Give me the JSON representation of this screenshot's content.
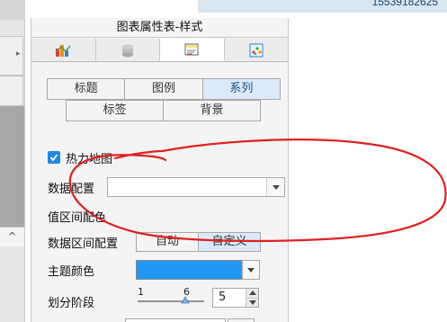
{
  "phone_number": "15539182625",
  "panel": {
    "title": "图表属性表-样式",
    "icon_tabs": [
      {
        "icon": "chart-type-icon"
      },
      {
        "icon": "database-icon"
      },
      {
        "icon": "style-icon"
      },
      {
        "icon": "effects-icon"
      }
    ],
    "tabs_row1": [
      "标题",
      "图例",
      "系列"
    ],
    "tabs_row2": [
      "标签",
      "背景"
    ],
    "active_tab": "系列"
  },
  "form": {
    "heatmap_label": "热力地图",
    "heatmap_checked": true,
    "data_config_label": "数据配置",
    "data_config_value": "",
    "value_range_color_label": "值区间配色",
    "data_range_label": "数据区间配置",
    "range_options": [
      "自动",
      "自定义"
    ],
    "range_selected": "自定义",
    "theme_color_label": "主题颜色",
    "theme_color": "#2196f3",
    "divide_stage_label": "划分阶段",
    "slider_min": "1",
    "slider_value": "6",
    "spin_value": "5"
  },
  "left_strip": {
    "arrow_right": "▸",
    "arrow_up": "^"
  }
}
